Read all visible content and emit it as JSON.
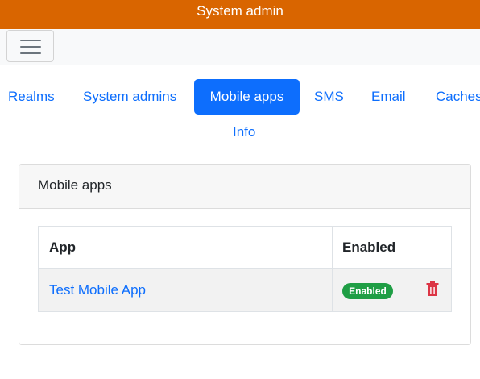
{
  "header": {
    "title": "System admin"
  },
  "navbar": {
    "menu_icon": "hamburger-menu-icon"
  },
  "tabs": [
    {
      "label": "Realms",
      "active": false
    },
    {
      "label": "System admins",
      "active": false
    },
    {
      "label": "Mobile apps",
      "active": true
    },
    {
      "label": "SMS",
      "active": false
    },
    {
      "label": "Email",
      "active": false
    },
    {
      "label": "Caches",
      "active": false
    },
    {
      "label": "Info",
      "active": false
    }
  ],
  "card": {
    "title": "Mobile apps"
  },
  "table": {
    "columns": [
      "App",
      "Enabled"
    ],
    "rows": [
      {
        "app": "Test Mobile App",
        "status": "Enabled",
        "delete_icon": "trash-icon"
      }
    ]
  },
  "colors": {
    "header_bg": "#d96500",
    "accent": "#0d6efd",
    "badge_success": "#1f9e45",
    "danger": "#dc3545"
  }
}
